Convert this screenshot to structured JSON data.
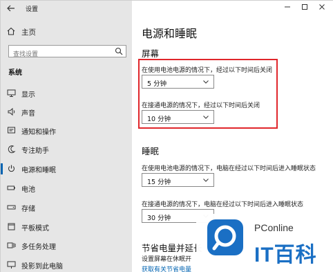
{
  "window": {
    "title": "设置"
  },
  "sidebar": {
    "home_label": "主页",
    "search_placeholder": "查找设置",
    "section_label": "系统",
    "items": [
      {
        "label": "显示",
        "icon": "monitor-icon"
      },
      {
        "label": "声音",
        "icon": "speaker-icon"
      },
      {
        "label": "通知和操作",
        "icon": "notification-icon"
      },
      {
        "label": "专注助手",
        "icon": "moon-icon"
      },
      {
        "label": "电源和睡眠",
        "icon": "power-icon",
        "active": true
      },
      {
        "label": "电池",
        "icon": "battery-icon"
      },
      {
        "label": "存储",
        "icon": "storage-icon"
      },
      {
        "label": "平板模式",
        "icon": "tablet-icon"
      },
      {
        "label": "多任务处理",
        "icon": "multitask-icon"
      },
      {
        "label": "投影到此电脑",
        "icon": "project-icon"
      }
    ]
  },
  "main": {
    "title": "电源和睡眠",
    "screen": {
      "heading": "屏幕",
      "battery_desc": "在使用电池电源的情况下，经过以下时间后关闭",
      "battery_value": "5 分钟",
      "plugged_desc": "在接通电源的情况下，经过以下时间后关闭",
      "plugged_value": "10 分钟"
    },
    "sleep": {
      "heading": "睡眠",
      "battery_desc": "在使用电池电源的情况下，电脑在经过以下时间后进入睡眠状态",
      "battery_value": "15 分钟",
      "plugged_desc": "在接通电源的情况下，电脑在经过以下时间后进入睡眠状态",
      "plugged_value": "30 分钟"
    },
    "save_heading": "节省电量并延长",
    "save_desc": "设置屏幕在休眠开",
    "save_link": "获取有关节省电量"
  },
  "watermark": {
    "line1": "PConline",
    "line2": "IT百科"
  },
  "colors": {
    "accent": "#0063b1",
    "highlight": "#e0262b",
    "sidebar_bg": "#e6e6e6"
  }
}
